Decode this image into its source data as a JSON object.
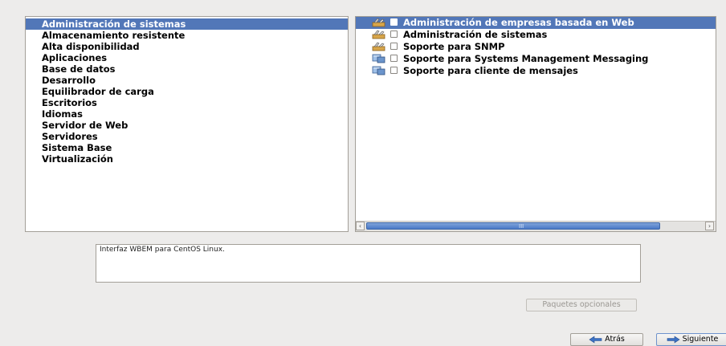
{
  "categories": [
    {
      "label": "Administración de sistemas",
      "selected": true
    },
    {
      "label": "Almacenamiento resistente",
      "selected": false
    },
    {
      "label": "Alta disponibilidad",
      "selected": false
    },
    {
      "label": "Aplicaciones",
      "selected": false
    },
    {
      "label": "Base de datos",
      "selected": false
    },
    {
      "label": "Desarrollo",
      "selected": false
    },
    {
      "label": "Equilibrador de carga",
      "selected": false
    },
    {
      "label": "Escritorios",
      "selected": false
    },
    {
      "label": "Idiomas",
      "selected": false
    },
    {
      "label": "Servidor de Web",
      "selected": false
    },
    {
      "label": "Servidores",
      "selected": false
    },
    {
      "label": "Sistema Base",
      "selected": false
    },
    {
      "label": "Virtualización",
      "selected": false
    }
  ],
  "package_groups": [
    {
      "label": "Administración de empresas basada en Web",
      "icon": "admin-tools-icon",
      "checked": false,
      "selected": true
    },
    {
      "label": "Administración de sistemas",
      "icon": "admin-tools-icon",
      "checked": false,
      "selected": false
    },
    {
      "label": "Soporte para SNMP",
      "icon": "admin-tools-icon",
      "checked": false,
      "selected": false
    },
    {
      "label": "Soporte para Systems Management Messaging",
      "icon": "network-server-icon",
      "checked": false,
      "selected": false
    },
    {
      "label": "Soporte para cliente de mensajes",
      "icon": "network-server-icon",
      "checked": false,
      "selected": false
    }
  ],
  "scrollbar": {
    "grip": "III"
  },
  "description": "Interfaz WBEM para CentOS Linux.",
  "buttons": {
    "optional_packages": "Paquetes opcionales",
    "back": "Atrás",
    "next": "Siguiente"
  },
  "colors": {
    "selection": "#5277b8",
    "background": "#edeceb"
  }
}
